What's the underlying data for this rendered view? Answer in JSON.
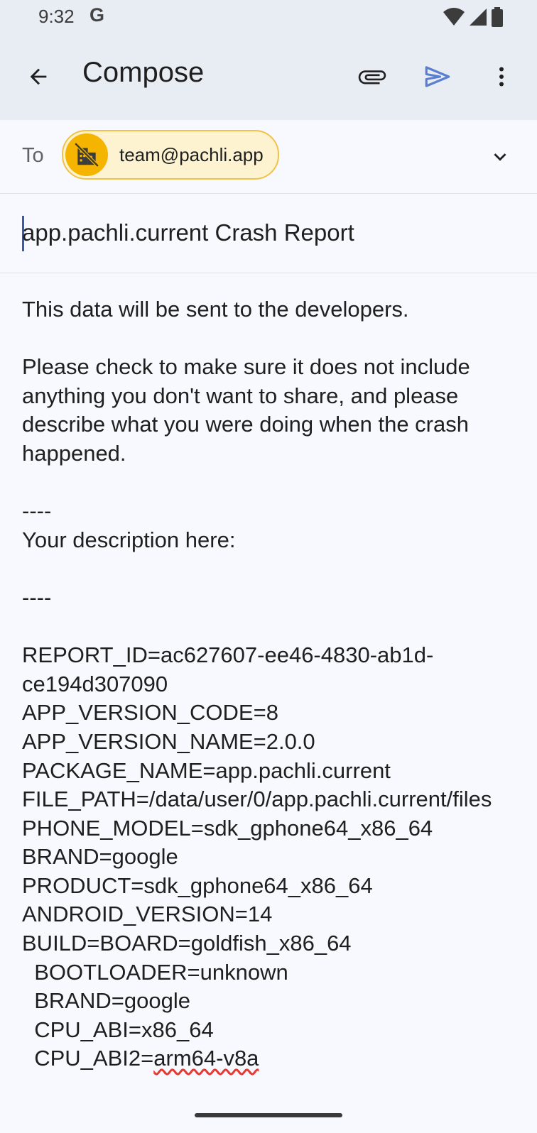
{
  "status_bar": {
    "time": "9:32",
    "g_label": "G"
  },
  "app_bar": {
    "title": "Compose"
  },
  "recipients": {
    "to_label": "To",
    "chip_email": "team@pachli.app"
  },
  "subject": {
    "value": "app.pachli.current Crash Report"
  },
  "body": {
    "lines": [
      "This data will be sent to the developers.",
      "",
      "Please check to make sure it does not include anything you don't want to share, and please describe what you were doing when the crash happened.",
      "",
      "----",
      "Your description here:",
      "",
      "----",
      "",
      "REPORT_ID=ac627607-ee46-4830-ab1d-ce194d307090",
      "APP_VERSION_CODE=8",
      "APP_VERSION_NAME=2.0.0",
      "PACKAGE_NAME=app.pachli.current",
      "FILE_PATH=/data/user/0/app.pachli.current/files",
      "PHONE_MODEL=sdk_gphone64_x86_64",
      "BRAND=google",
      "PRODUCT=sdk_gphone64_x86_64",
      "ANDROID_VERSION=14",
      "BUILD=BOARD=goldfish_x86_64",
      "  BOOTLOADER=unknown",
      "  BRAND=google",
      "  CPU_ABI=x86_64"
    ],
    "last_line_prefix": "  CPU_ABI2=",
    "last_line_misspelled": "arm64-v8a"
  },
  "icons": {
    "back": "arrow-back-icon",
    "attach": "paperclip-icon",
    "send": "send-icon",
    "more": "more-vert-icon",
    "avatar": "domain-disabled-icon",
    "expand": "chevron-down-icon"
  },
  "colors": {
    "app_bar_bg": "#e8ecf3",
    "send_accent": "#5b7fd0",
    "chip_bg": "#fdf3d0",
    "chip_border": "#f1c24a",
    "avatar_bg": "#f4b400",
    "cursor": "#3b5ba5"
  }
}
